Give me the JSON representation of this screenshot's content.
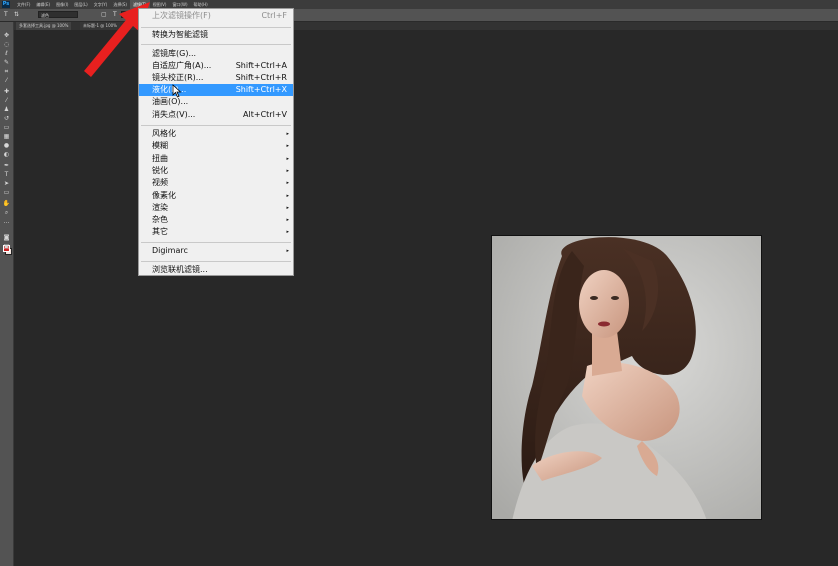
{
  "app": {
    "logo": "Ps"
  },
  "menubar": {
    "items": [
      "文件(F)",
      "编辑(E)",
      "图像(I)",
      "图层(L)",
      "文字(Y)",
      "选择(S)",
      "滤镜(T)",
      "视图(V)",
      "窗口(W)",
      "帮助(H)"
    ],
    "active": "滤镜(T)"
  },
  "options": {
    "field1": "滤色",
    "field2": "滤色"
  },
  "document_tabs": [
    "多套选择工具.jpg @ 100%",
    "未标题-1 @ 100%"
  ],
  "filter_menu": {
    "last_filter": {
      "label": "上次滤镜操作(F)",
      "shortcut": "Ctrl+F"
    },
    "convert": "转换为智能滤镜",
    "group1": [
      {
        "label": "滤镜库(G)...",
        "shortcut": ""
      },
      {
        "label": "自适应广角(A)...",
        "shortcut": "Shift+Ctrl+A"
      },
      {
        "label": "镜头校正(R)...",
        "shortcut": "Shift+Ctrl+R"
      },
      {
        "label": "液化(L)...",
        "shortcut": "Shift+Ctrl+X"
      },
      {
        "label": "油画(O)...",
        "shortcut": ""
      },
      {
        "label": "消失点(V)...",
        "shortcut": "Alt+Ctrl+V"
      }
    ],
    "submenus": [
      "风格化",
      "模糊",
      "扭曲",
      "锐化",
      "视频",
      "像素化",
      "渲染",
      "杂色",
      "其它"
    ],
    "digimarc": "Digimarc",
    "browse": "浏览联机滤镜...",
    "highlighted": "液化(L)...",
    "submenu_arrow": "▸"
  },
  "colors": {
    "highlight": "#3399ff",
    "arrow": "#e8201f",
    "foreground": "#cc2222"
  }
}
